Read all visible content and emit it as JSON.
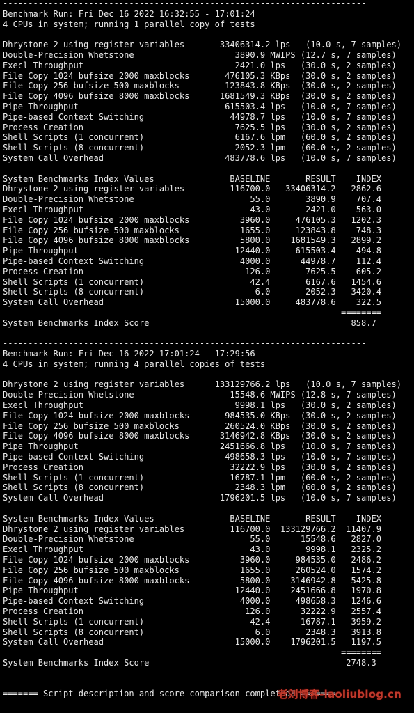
{
  "theme": {
    "background": "#000000",
    "foreground": "#e8e8e8",
    "watermark_color": "#c0392b"
  },
  "terminal_lines": [
    "------------------------------------------------------------------------",
    "Benchmark Run: Fri Dec 16 2022 16:32:55 - 17:01:24",
    "4 CPUs in system; running 1 parallel copy of tests",
    "",
    "Dhrystone 2 using register variables       33406314.2 lps   (10.0 s, 7 samples)",
    "Double-Precision Whetstone                    3890.9 MWIPS (12.7 s, 7 samples)",
    "Execl Throughput                              2421.0 lps   (30.0 s, 2 samples)",
    "File Copy 1024 bufsize 2000 maxblocks       476105.3 KBps  (30.0 s, 2 samples)",
    "File Copy 256 bufsize 500 maxblocks         123843.8 KBps  (30.0 s, 2 samples)",
    "File Copy 4096 bufsize 8000 maxblocks      1681549.3 KBps  (30.0 s, 2 samples)",
    "Pipe Throughput                             615503.4 lps   (10.0 s, 7 samples)",
    "Pipe-based Context Switching                 44978.7 lps   (10.0 s, 7 samples)",
    "Process Creation                              7625.5 lps   (30.0 s, 2 samples)",
    "Shell Scripts (1 concurrent)                  6167.6 lpm   (60.0 s, 2 samples)",
    "Shell Scripts (8 concurrent)                  2052.3 lpm   (60.0 s, 2 samples)",
    "System Call Overhead                        483778.6 lps   (10.0 s, 7 samples)",
    "",
    "System Benchmarks Index Values               BASELINE       RESULT    INDEX",
    "Dhrystone 2 using register variables         116700.0   33406314.2   2862.6",
    "Double-Precision Whetstone                       55.0       3890.9    707.4",
    "Execl Throughput                                 43.0       2421.0    563.0",
    "File Copy 1024 bufsize 2000 maxblocks          3960.0     476105.3   1202.3",
    "File Copy 256 bufsize 500 maxblocks            1655.0     123843.8    748.3",
    "File Copy 4096 bufsize 8000 maxblocks          5800.0    1681549.3   2899.2",
    "Pipe Throughput                               12440.0     615503.4    494.8",
    "Pipe-based Context Switching                   4000.0      44978.7    112.4",
    "Process Creation                                126.0       7625.5    605.2",
    "Shell Scripts (1 concurrent)                     42.4       6167.6   1454.6",
    "Shell Scripts (8 concurrent)                      6.0       2052.3   3420.4",
    "System Call Overhead                          15000.0     483778.6    322.5",
    "                                                                   ========",
    "System Benchmarks Index Score                                        858.7",
    "",
    "------------------------------------------------------------------------",
    "Benchmark Run: Fri Dec 16 2022 17:01:24 - 17:29:56",
    "4 CPUs in system; running 4 parallel copies of tests",
    "",
    "Dhrystone 2 using register variables      133129766.2 lps   (10.0 s, 7 samples)",
    "Double-Precision Whetstone                   15548.6 MWIPS (12.8 s, 7 samples)",
    "Execl Throughput                              9998.1 lps   (30.0 s, 2 samples)",
    "File Copy 1024 bufsize 2000 maxblocks       984535.0 KBps  (30.0 s, 2 samples)",
    "File Copy 256 bufsize 500 maxblocks         260524.0 KBps  (30.0 s, 2 samples)",
    "File Copy 4096 bufsize 8000 maxblocks      3146942.8 KBps  (30.0 s, 2 samples)",
    "Pipe Throughput                            2451666.8 lps   (10.0 s, 7 samples)",
    "Pipe-based Context Switching                498658.3 lps   (10.0 s, 7 samples)",
    "Process Creation                             32222.9 lps   (30.0 s, 2 samples)",
    "Shell Scripts (1 concurrent)                 16787.1 lpm   (60.0 s, 2 samples)",
    "Shell Scripts (8 concurrent)                  2348.3 lpm   (60.0 s, 2 samples)",
    "System Call Overhead                       1796201.5 lps   (10.0 s, 7 samples)",
    "",
    "System Benchmarks Index Values               BASELINE       RESULT    INDEX",
    "Dhrystone 2 using register variables         116700.0  133129766.2  11407.9",
    "Double-Precision Whetstone                       55.0      15548.6   2827.0",
    "Execl Throughput                                 43.0       9998.1   2325.2",
    "File Copy 1024 bufsize 2000 maxblocks          3960.0     984535.0   2486.2",
    "File Copy 256 bufsize 500 maxblocks            1655.0     260524.0   1574.2",
    "File Copy 4096 bufsize 8000 maxblocks          5800.0    3146942.8   5425.8",
    "Pipe Throughput                               12440.0    2451666.8   1970.8",
    "Pipe-based Context Switching                   4000.0     498658.3   1246.6",
    "Process Creation                                126.0      32222.9   2557.4",
    "Shell Scripts (1 concurrent)                     42.4      16787.1   3959.2",
    "Shell Scripts (8 concurrent)                      6.0       2348.3   3913.8",
    "System Call Overhead                          15000.0    1796201.5   1197.5",
    "                                                                   ========",
    "System Benchmarks Index Score                                       2748.3",
    "",
    "",
    "======= Script description and score comparison completed! ======="
  ],
  "watermark": "老刘博客-laoliublog.cn"
}
